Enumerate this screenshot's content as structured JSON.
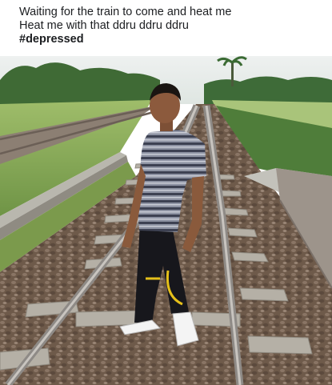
{
  "post": {
    "line1": "Waiting for the train to come and heat me",
    "line2": "Heat me with that ddru ddru ddru",
    "hashtag": "#depressed"
  },
  "photo": {
    "icon": "photo-of-man-standing-on-railway-tracks"
  }
}
